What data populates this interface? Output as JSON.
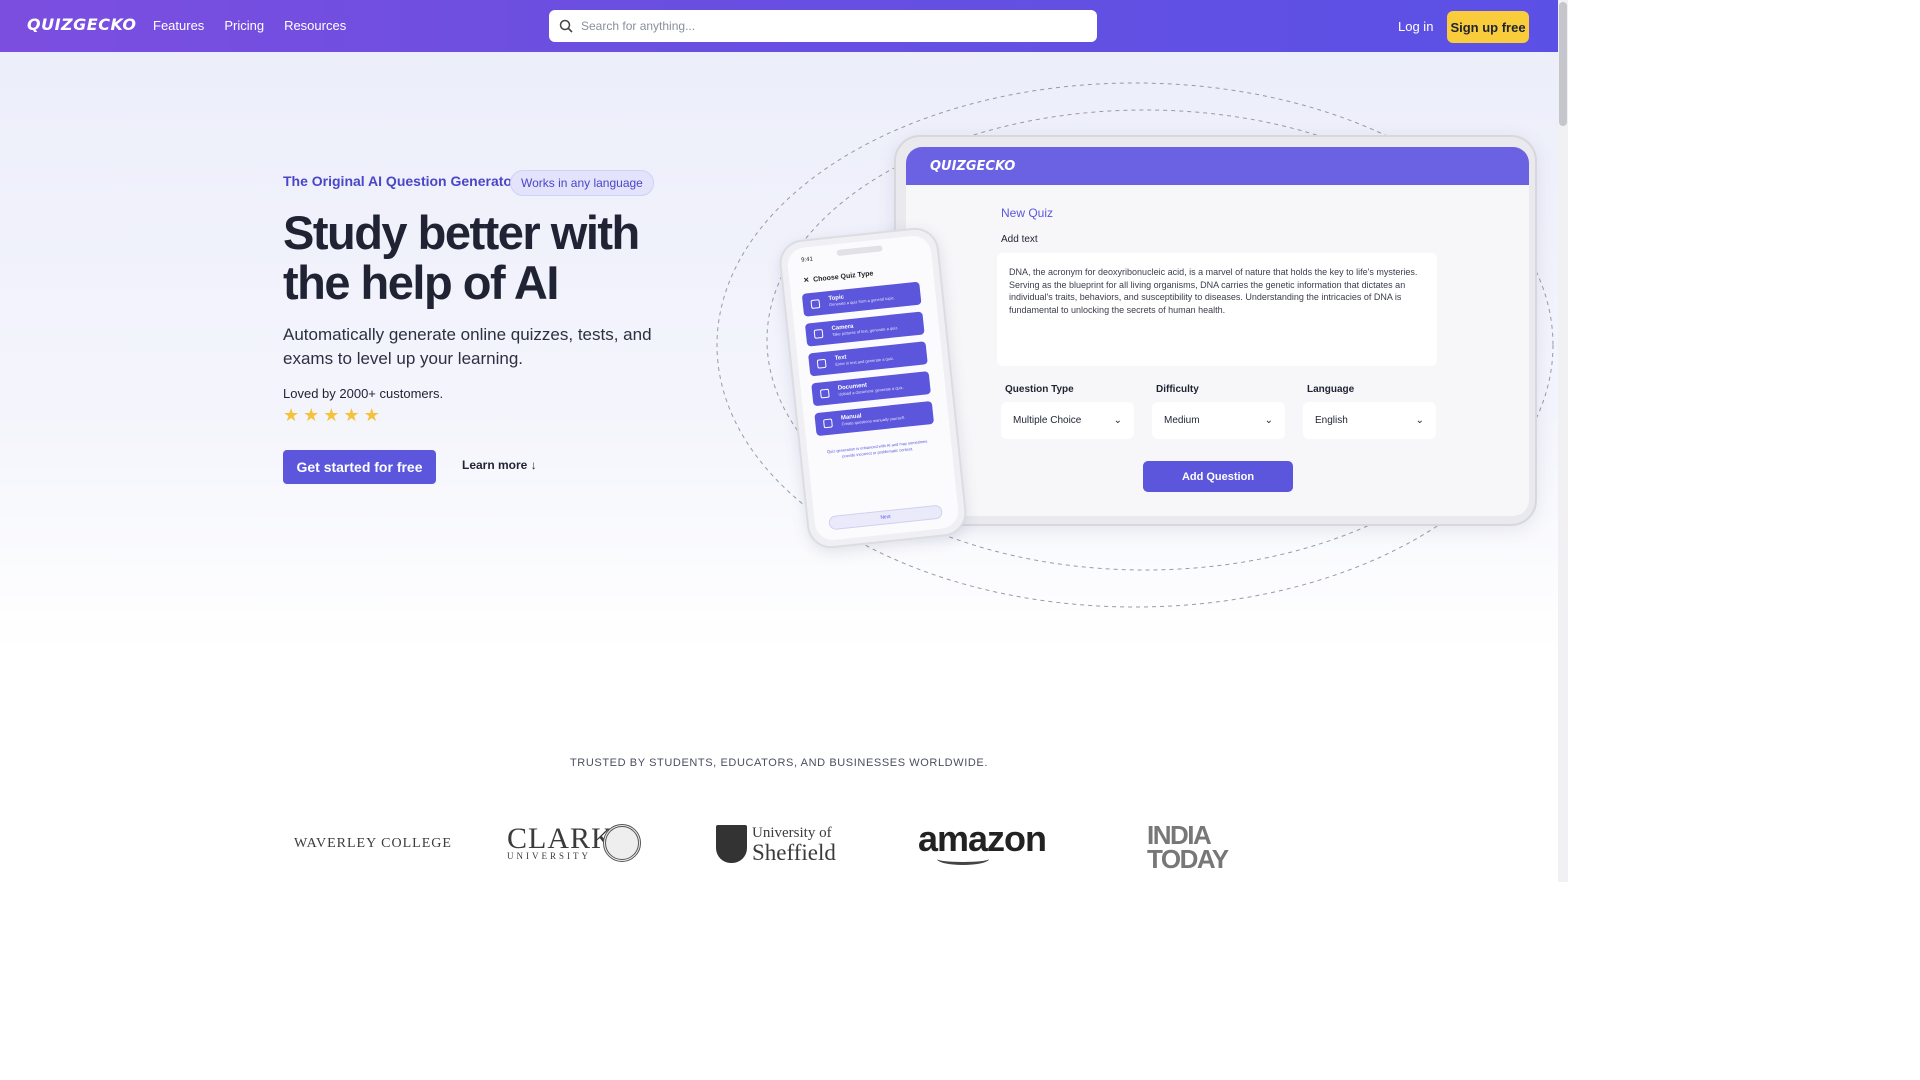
{
  "nav": {
    "logo": "QUIZGECKO",
    "links": [
      "Features",
      "Pricing",
      "Resources"
    ],
    "search_placeholder": "Search for anything...",
    "login": "Log in",
    "signup": "Sign up free"
  },
  "hero": {
    "eyebrow": "The Original AI Question Generator",
    "badge": "Works in any language",
    "title": "Study better with the help of AI",
    "subtitle": "Automatically generate online quizzes, tests, and exams to level up your learning.",
    "loved": "Loved by 2000+ customers.",
    "rating_stars": 5,
    "cta": "Get started for free",
    "learn_more": "Learn more ↓"
  },
  "tablet": {
    "logo": "QUIZGECKO",
    "title": "New Quiz",
    "add_text_label": "Add text",
    "text": "DNA, the acronym for deoxyribonucleic acid, is a marvel of nature that holds the key to life's mysteries. Serving as the blueprint for all living organisms, DNA carries the genetic information that dictates an individual's traits, behaviors, and susceptibility to diseases. Understanding the intricacies of DNA is fundamental to unlocking the secrets of human health.",
    "question_type_label": "Question Type",
    "question_type_value": "Multiple Choice",
    "difficulty_label": "Difficulty",
    "difficulty_value": "Medium",
    "language_label": "Language",
    "language_value": "English",
    "add_button": "Add Question"
  },
  "phone": {
    "time": "9:41",
    "heading": "Choose Quiz Type",
    "items": [
      {
        "title": "Topic",
        "sub": "Generate a quiz from a general topic."
      },
      {
        "title": "Camera",
        "sub": "Take pictures of text, generate a quiz."
      },
      {
        "title": "Text",
        "sub": "Enter in text and generate a quiz."
      },
      {
        "title": "Document",
        "sub": "Upload a document, generate a quiz."
      },
      {
        "title": "Manual",
        "sub": "Create questions manually yourself."
      }
    ],
    "note": "Quiz generation is enhanced with AI and may sometimes provide incorrect or problematic content.",
    "next": "Next"
  },
  "trusted": {
    "heading": "TRUSTED BY STUDENTS, EDUCATORS, AND BUSINESSES WORLDWIDE.",
    "logos": {
      "waverley": "WAVERLEY COLLEGE",
      "clark_big": "CLARK",
      "clark_small": "UNIVERSITY",
      "sheffield_l1": "University of",
      "sheffield_l2": "Sheffield",
      "amazon": "amazon",
      "india_l1": "INDIA",
      "india_l2": "TODAY"
    }
  },
  "colors": {
    "brand": "#5b56dc",
    "nav_gradient_start": "#7c4ee0",
    "signup_yellow": "#f8cc3a",
    "star": "#f5c33b"
  }
}
